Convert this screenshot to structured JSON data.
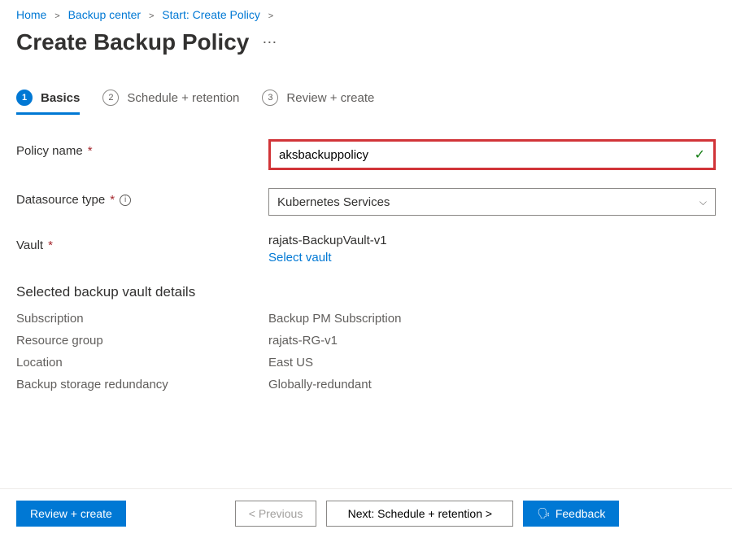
{
  "breadcrumb": {
    "items": [
      {
        "label": "Home"
      },
      {
        "label": "Backup center"
      },
      {
        "label": "Start: Create Policy"
      }
    ]
  },
  "page": {
    "title": "Create Backup Policy"
  },
  "tabs": {
    "items": [
      {
        "num": "1",
        "label": "Basics"
      },
      {
        "num": "2",
        "label": "Schedule + retention"
      },
      {
        "num": "3",
        "label": "Review + create"
      }
    ]
  },
  "form": {
    "policy_name": {
      "label": "Policy name",
      "value": "aksbackuppolicy"
    },
    "datasource": {
      "label": "Datasource type",
      "value": "Kubernetes Services"
    },
    "vault": {
      "label": "Vault",
      "value": "rajats-BackupVault-v1",
      "select_link": "Select vault"
    }
  },
  "vault_details": {
    "title": "Selected backup vault details",
    "rows": [
      {
        "k": "Subscription",
        "v": "Backup PM Subscription"
      },
      {
        "k": "Resource group",
        "v": "rajats-RG-v1"
      },
      {
        "k": "Location",
        "v": "East US"
      },
      {
        "k": "Backup storage redundancy",
        "v": "Globally-redundant"
      }
    ]
  },
  "footer": {
    "review": "Review + create",
    "prev": "< Previous",
    "next": "Next: Schedule + retention >",
    "feedback": "Feedback"
  }
}
